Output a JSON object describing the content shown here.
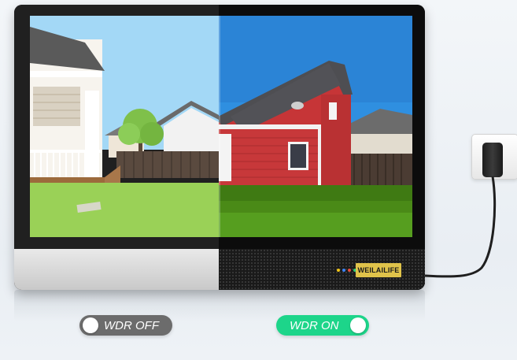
{
  "brand": {
    "name": "WEILAILIFE"
  },
  "toggles": {
    "off": {
      "label": "WDR OFF",
      "color": "#6c6c6c"
    },
    "on": {
      "label": "WDR ON",
      "color": "#1dd58a"
    }
  },
  "leds": [
    {
      "color": "#f0c419"
    },
    {
      "color": "#3b82f6"
    },
    {
      "color": "#e74c3c"
    },
    {
      "color": "#2ecc71"
    }
  ],
  "colors": {
    "sky_left": "#7ec6ef",
    "sky_right": "#2f91e0",
    "house_red": "#c9373a",
    "grass_left": "#8cc63f",
    "grass_right": "#4f8f1a"
  }
}
